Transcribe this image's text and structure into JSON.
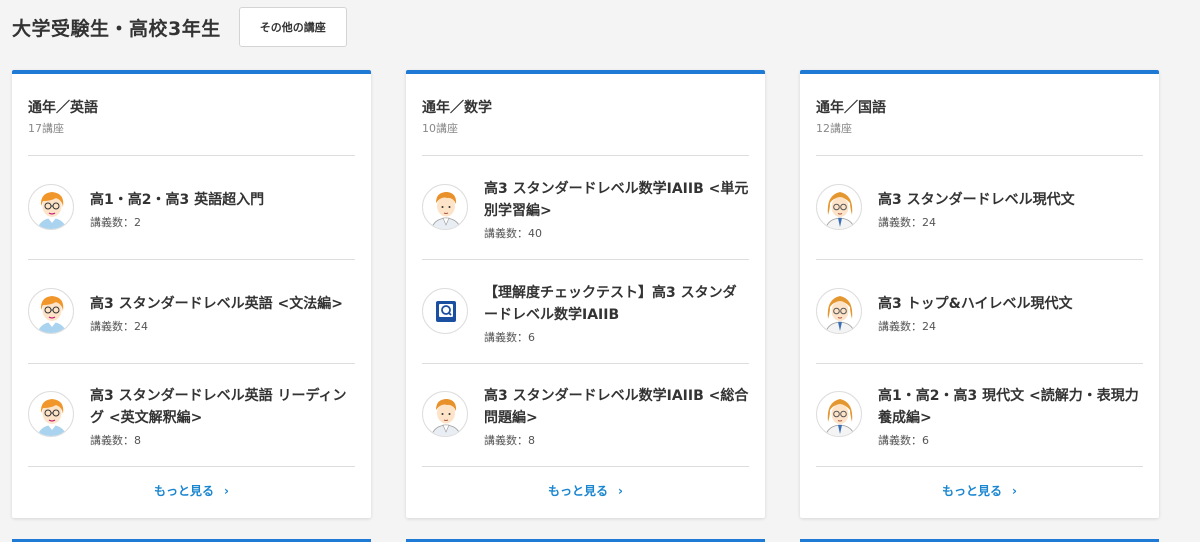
{
  "page_title": "大学受験生・高校3年生",
  "other_button": "その他の講座",
  "colors": {
    "accent": "#1f7ad6",
    "link": "#1a86d0"
  },
  "cards": [
    {
      "title": "通年／英語",
      "count": "17講座",
      "more_label": "もっと見る",
      "items": [
        {
          "title": "高1・高2・高3 英語超入門",
          "meta": "講義数：2",
          "icon": "teacher-avatar-icon"
        },
        {
          "title": "高3 スタンダードレベル英語 <文法編>",
          "meta": "講義数：24",
          "icon": "teacher-avatar-icon"
        },
        {
          "title": "高3 スタンダードレベル英語 リーディング <英文解釈編>",
          "meta": "講義数：8",
          "icon": "teacher-avatar-icon"
        }
      ]
    },
    {
      "title": "通年／数学",
      "count": "10講座",
      "more_label": "もっと見る",
      "items": [
        {
          "title": "高3 スタンダードレベル数学IAIIB <単元別学習編>",
          "meta": "講義数：40",
          "icon": "teacher-avatar-icon"
        },
        {
          "title": "【理解度チェックテスト】高3 スタンダードレベル数学IAIIB",
          "meta": "講義数：6",
          "icon": "check-test-icon"
        },
        {
          "title": "高3 スタンダードレベル数学IAIIB <総合問題編>",
          "meta": "講義数：8",
          "icon": "teacher-avatar-icon"
        }
      ]
    },
    {
      "title": "通年／国語",
      "count": "12講座",
      "more_label": "もっと見る",
      "items": [
        {
          "title": "高3 スタンダードレベル現代文",
          "meta": "講義数：24",
          "icon": "teacher-avatar-icon"
        },
        {
          "title": "高3 トップ&ハイレベル現代文",
          "meta": "講義数：24",
          "icon": "teacher-avatar-icon"
        },
        {
          "title": "高1・高2・高3 現代文 <読解力・表現力養成編>",
          "meta": "講義数：6",
          "icon": "teacher-avatar-icon"
        }
      ]
    }
  ]
}
